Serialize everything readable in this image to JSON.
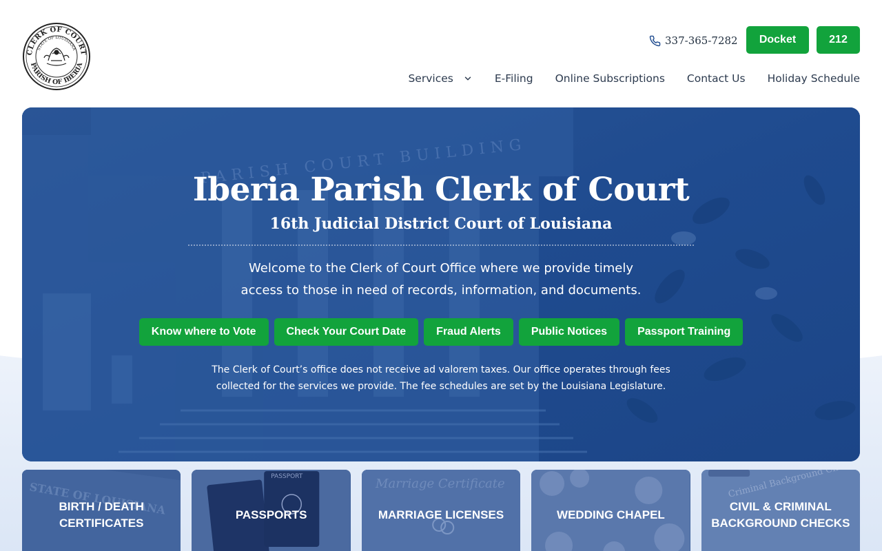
{
  "colors": {
    "primary_green": "#12a33c",
    "hero_blue": "#1f4b8f",
    "text_dark": "#1f2d3d"
  },
  "logo": {
    "seal_top_text": "CLERK OF COURT",
    "seal_mid_text": "STATE OF LOUISIANA",
    "seal_bottom_text": "PARISH OF IBERIA",
    "icon": "pelican-seal-icon"
  },
  "header": {
    "phone": {
      "icon": "phone-icon",
      "number": "337-365-7282"
    },
    "docket_label": "Docket",
    "button_212_label": "212"
  },
  "nav": {
    "items": [
      {
        "label": "Services",
        "has_dropdown": true
      },
      {
        "label": "E-Filing"
      },
      {
        "label": "Online Subscriptions"
      },
      {
        "label": "Contact Us"
      },
      {
        "label": "Holiday Schedule"
      }
    ]
  },
  "hero": {
    "title": "Iberia Parish Clerk of Court",
    "subtitle": "16th Judicial District Court of Louisiana",
    "welcome_line1": "Welcome to the Clerk of Court Office where we provide timely",
    "welcome_line2": "access to those in need of records, information, and documents.",
    "actions": [
      "Know where to Vote",
      "Check Your Court Date",
      "Fraud Alerts",
      "Public Notices",
      "Passport Training"
    ],
    "note_line1": "The Clerk of Court’s office does not receive ad valorem taxes. Our office operates through fees",
    "note_line2": "collected for the services we provide. The fee schedules are set by the Louisiana Legislature.",
    "bg_text": "PARISH COURT BUILDING"
  },
  "cards": [
    {
      "label": "BIRTH / DEATH\nCERTIFICATES",
      "bg_text": "STATE OF LOUISIANA"
    },
    {
      "label": "PASSPORTS",
      "bg_text": "PASSPORT"
    },
    {
      "label": "MARRIAGE LICENSES",
      "bg_text": "Marriage Certificate"
    },
    {
      "label": "WEDDING CHAPEL",
      "bg_text": ""
    },
    {
      "label": "CIVIL & CRIMINAL\nBACKGROUND CHECKS",
      "bg_text": "Criminal Background Check"
    }
  ]
}
